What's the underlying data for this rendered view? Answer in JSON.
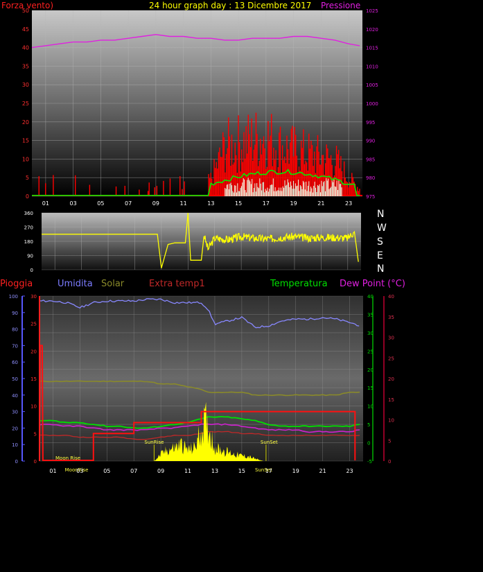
{
  "colors": {
    "wind": "#ff0000",
    "pressure": "#e020e0",
    "gust": "#00ee00",
    "windLow": "#e8ffe8",
    "direction": "#ffff00",
    "rain": "#5858ff",
    "humidity": "#8888ff",
    "solar": "#8a8a2a",
    "extra": "#c02828",
    "temp": "#00e000",
    "dew": "#d020d0",
    "sun": "#ffff00",
    "grid": "#b8b8b8"
  },
  "header": {
    "title": "24 hour graph day : 13 Dicembre 2017",
    "wind_label": "Forza vento)",
    "pressure_label": "Pressione"
  },
  "legend": {
    "rain": "Pioggia",
    "humidity": "Umidita",
    "solar": "Solar",
    "extra": "Extra temp1",
    "temp": "Temperatura",
    "dew": "Dew Point (°C)"
  },
  "compass": [
    "N",
    "W",
    "S",
    "E",
    "N"
  ],
  "time_ticks": [
    "01",
    "03",
    "05",
    "07",
    "09",
    "11",
    "13",
    "15",
    "17",
    "19",
    "21",
    "23"
  ],
  "chart_data": [
    {
      "type": "line",
      "title": "",
      "x_hours": [
        0,
        1,
        2,
        3,
        4,
        5,
        6,
        7,
        8,
        9,
        10,
        11,
        12,
        13,
        14,
        15,
        16,
        17,
        18,
        19,
        20,
        21,
        22,
        23,
        23.8
      ],
      "ylim": [
        0,
        50
      ],
      "y_ticks": [
        "0",
        "5",
        "10",
        "15",
        "20",
        "25",
        "30",
        "35",
        "40",
        "45",
        "50"
      ],
      "y2lim": [
        975,
        1025
      ],
      "y2_ticks": [
        "975",
        "980",
        "985",
        "990",
        "995",
        "1000",
        "1005",
        "1010",
        "1015",
        "1020",
        "1025"
      ],
      "series": [
        {
          "name": "Forza vento)",
          "axis": "left",
          "values": [
            0,
            2,
            0,
            3,
            0,
            3,
            2,
            0,
            0,
            2,
            0,
            0,
            0,
            5,
            14,
            15,
            16,
            17,
            14,
            13,
            12,
            11,
            10,
            5,
            2
          ]
        },
        {
          "name": "Pressione",
          "axis": "right",
          "values": [
            1015,
            1015.5,
            1016,
            1016.5,
            1016.5,
            1017,
            1017,
            1017.5,
            1018,
            1018.5,
            1018,
            1018,
            1017.5,
            1017.5,
            1017,
            1017,
            1017.5,
            1017.5,
            1017.5,
            1018,
            1018,
            1017.5,
            1017,
            1016,
            1015.5
          ]
        }
      ]
    },
    {
      "type": "line",
      "title": "",
      "ylim": [
        0,
        360
      ],
      "y_ticks": [
        "0",
        "90",
        "180",
        "270",
        "360"
      ],
      "x_hours": [
        0,
        8.7,
        9.0,
        9.5,
        10,
        10.8,
        11.0,
        11.2,
        12.0,
        12.2,
        12.5,
        13,
        14,
        15,
        16,
        17,
        18,
        19,
        20,
        21,
        22,
        23,
        23.5,
        23.8
      ],
      "series": [
        {
          "name": "",
          "values": [
            225,
            225,
            10,
            160,
            170,
            170,
            360,
            60,
            60,
            220,
            130,
            200,
            190,
            210,
            200,
            195,
            205,
            210,
            200,
            205,
            205,
            200,
            240,
            50
          ]
        }
      ]
    },
    {
      "type": "line",
      "title": "",
      "x_hours": [
        0,
        1,
        2,
        3,
        4,
        5,
        6,
        7,
        8,
        9,
        10,
        11,
        12,
        12.5,
        13,
        14,
        15,
        16,
        17,
        18,
        19,
        20,
        21,
        22,
        23,
        23.8
      ],
      "axes": {
        "rain": {
          "ylim": [
            0,
            100
          ],
          "ticks": [
            "0",
            "10",
            "20",
            "30",
            "40",
            "50",
            "60",
            "70",
            "80",
            "90",
            "100"
          ]
        },
        "solar": {
          "ylim": [
            0,
            30
          ],
          "ticks": [
            "0",
            "5",
            "10",
            "15",
            "20",
            "25",
            "30"
          ]
        },
        "temp": {
          "ylim": [
            -5,
            40
          ],
          "ticks": [
            "-5",
            "0",
            "5",
            "10",
            "15",
            "20",
            "25",
            "30",
            "35",
            "40"
          ]
        },
        "dew": {
          "ylim": [
            0,
            40
          ],
          "ticks": [
            "0",
            "5",
            "10",
            "15",
            "20",
            "25",
            "30",
            "35",
            "40"
          ]
        }
      },
      "series": [
        {
          "name": "Umidita",
          "values": [
            97,
            97,
            96,
            93,
            96,
            97,
            97,
            97,
            98,
            98,
            96,
            96,
            96,
            92,
            83,
            85,
            87,
            81,
            82,
            85,
            86,
            86,
            87,
            86,
            84,
            82
          ]
        },
        {
          "name": "Temperatura",
          "values": [
            6,
            6,
            5.5,
            5.5,
            5,
            4.5,
            4.5,
            4,
            4,
            4.5,
            5,
            5.5,
            6.5,
            7,
            7,
            7,
            6.5,
            6,
            5,
            4.5,
            4.5,
            4.5,
            4.5,
            4.5,
            4.5,
            5
          ]
        },
        {
          "name": "Dew Point (°C)",
          "values": [
            5,
            5,
            4.5,
            4.5,
            4,
            3.5,
            3.5,
            3.5,
            3.5,
            4,
            4,
            4.5,
            5,
            5,
            5,
            5,
            4.5,
            4,
            3.5,
            3.5,
            3.5,
            3,
            3,
            3,
            3,
            3.5
          ]
        },
        {
          "name": "Extra temp1",
          "values": [
            2,
            2,
            2,
            1.5,
            1.5,
            1.5,
            1.5,
            1,
            1,
            1.5,
            2,
            2,
            2.5,
            3,
            3,
            3,
            2.5,
            2.5,
            2,
            2,
            2,
            2,
            2,
            2,
            2,
            2
          ]
        },
        {
          "name": "Solar",
          "values": [
            14.5,
            14.5,
            14.5,
            14.5,
            14.5,
            14.5,
            14.5,
            14.5,
            14.5,
            14,
            14,
            13.5,
            13,
            12.5,
            12.5,
            12.5,
            12.5,
            12,
            12,
            12,
            12,
            12,
            12,
            12,
            12.5,
            12.5
          ]
        },
        {
          "name": "Pioggia",
          "rain_rate": [
            {
              "x": 0,
              "y": 0
            },
            {
              "x": 0.05,
              "y": 21
            },
            {
              "x": 0.2,
              "y": 21
            },
            {
              "x": 0.25,
              "y": 0
            },
            {
              "x": 4,
              "y": 0
            },
            {
              "x": 4,
              "y": 5
            },
            {
              "x": 7,
              "y": 5
            },
            {
              "x": 7,
              "y": 7
            },
            {
              "x": 12,
              "y": 7
            },
            {
              "x": 12,
              "y": 9
            },
            {
              "x": 23.4,
              "y": 9
            },
            {
              "x": 23.4,
              "y": 0
            }
          ]
        }
      ],
      "sun": [
        {
          "label": "SunRise",
          "x": 8.5
        },
        {
          "label": "SunSet",
          "x": 16.8
        }
      ],
      "moon": [
        {
          "label": "Moon Rise",
          "x": 1.8
        },
        {
          "label": "MoonRise",
          "x": 2.5
        },
        {
          "label": "SunSet",
          "x": 16.6
        }
      ],
      "solar_peaks": [
        [
          8.5,
          0
        ],
        [
          9,
          1.5
        ],
        [
          9.5,
          2.5
        ],
        [
          10,
          3
        ],
        [
          10.5,
          3.8
        ],
        [
          11,
          2.5
        ],
        [
          11.5,
          3
        ],
        [
          12,
          7
        ],
        [
          12.3,
          9
        ],
        [
          12.6,
          7
        ],
        [
          13,
          3
        ],
        [
          13.5,
          2.5
        ],
        [
          14,
          2
        ],
        [
          14.5,
          1.5
        ],
        [
          15,
          1.2
        ],
        [
          15.5,
          1
        ],
        [
          16,
          0.5
        ],
        [
          16.6,
          0
        ]
      ]
    }
  ]
}
